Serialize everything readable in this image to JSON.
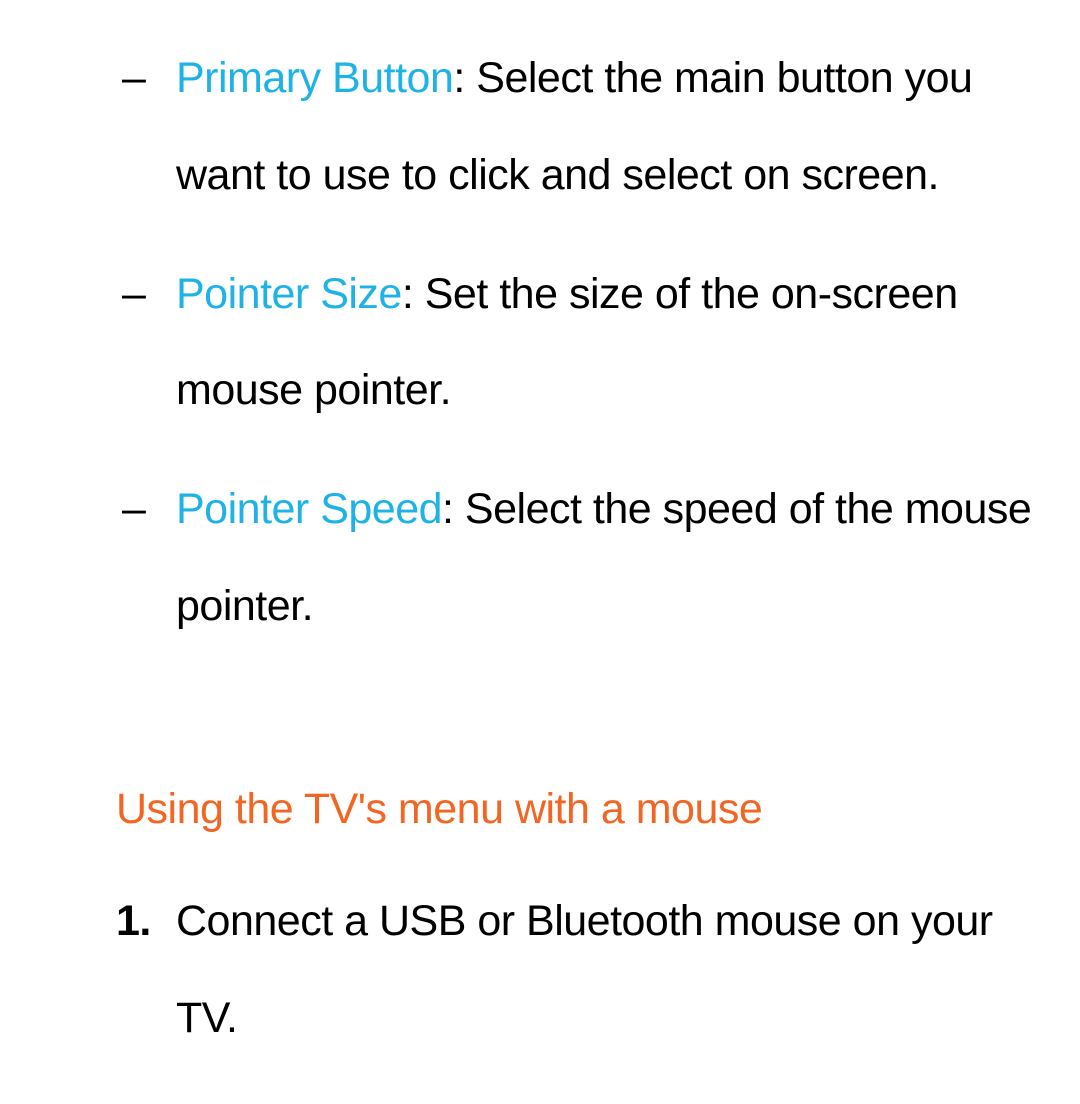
{
  "bullets": [
    {
      "marker": "–",
      "term": "Primary Button",
      "desc": ": Select the main button you want to use to click and select on screen."
    },
    {
      "marker": "–",
      "term": "Pointer Size",
      "desc": ": Set the size of the on-screen mouse pointer."
    },
    {
      "marker": "–",
      "term": "Pointer Speed",
      "desc": ": Select the speed of the mouse pointer."
    }
  ],
  "heading": "Using the TV's menu with a mouse",
  "steps": [
    {
      "num": "1.",
      "text": "Connect a USB or Bluetooth mouse on your TV."
    }
  ]
}
